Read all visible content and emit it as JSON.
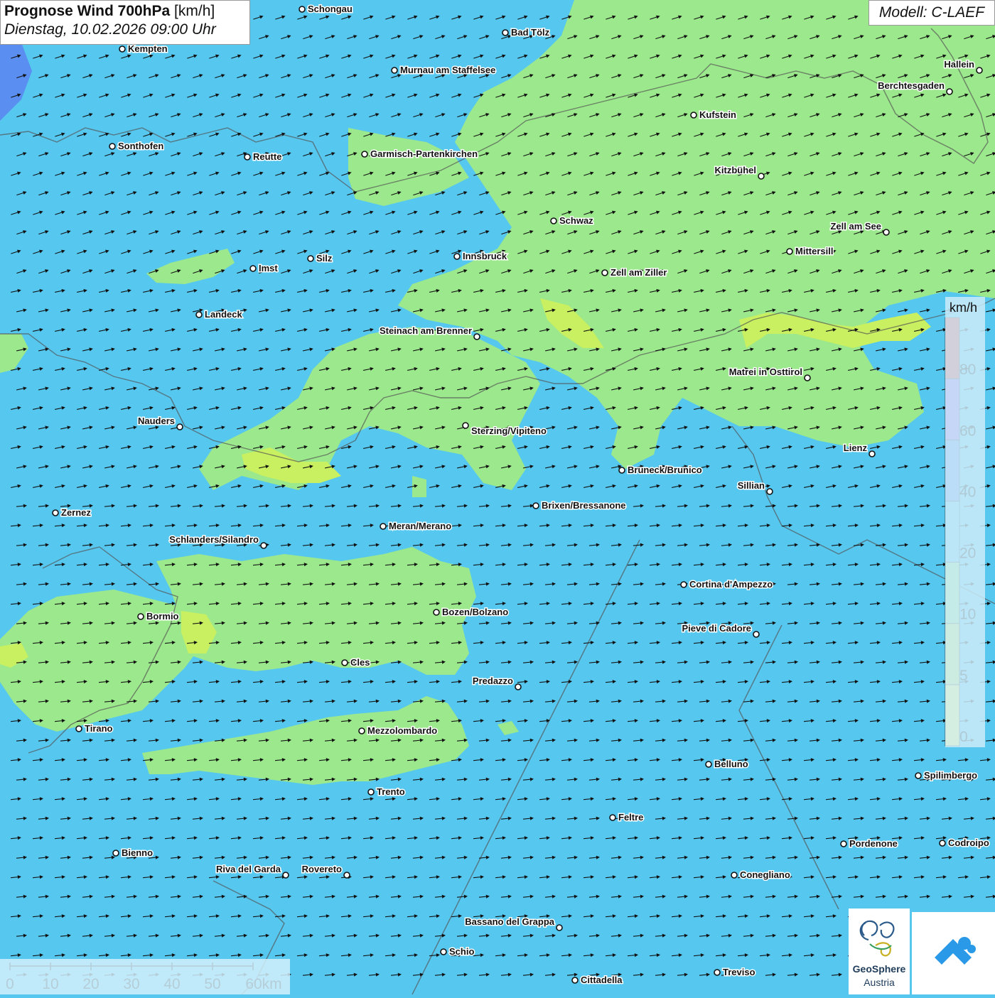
{
  "header": {
    "title_bold": "Prognose Wind 700hPa",
    "title_unit": "[km/h]",
    "subtitle": "Dienstag, 10.02.2026 09:00 Uhr",
    "model": "Modell: C-LAEF"
  },
  "legend": {
    "unit": "km/h",
    "colors": [
      "#ffff66",
      "#c8f060",
      "#9ce88c",
      "#56c7ef",
      "#5b8ef0",
      "#9a5cf0",
      "#f03a3a"
    ],
    "labels": [
      "0",
      "5",
      "10",
      "20",
      "40",
      "60",
      "80"
    ]
  },
  "scale": {
    "ticks": [
      "0",
      "10",
      "20",
      "30",
      "40",
      "50",
      "60km"
    ]
  },
  "logo": {
    "line1": "GeoSphere",
    "line2": "Austria"
  },
  "cities": [
    {
      "name": "Schongau",
      "side": "r"
    },
    {
      "name": "Bad Tölz",
      "side": "r"
    },
    {
      "name": "Kempten",
      "side": "r"
    },
    {
      "name": "Murnau am Staffelsee",
      "side": "r"
    },
    {
      "name": "Hallein",
      "side": "l"
    },
    {
      "name": "Berchtesgaden",
      "side": "l"
    },
    {
      "name": "Kufstein",
      "side": "r"
    },
    {
      "name": "Sonthofen",
      "side": "r"
    },
    {
      "name": "Reutte",
      "side": "r"
    },
    {
      "name": "Garmisch-Partenkirchen",
      "side": "r"
    },
    {
      "name": "Kitzbühel",
      "side": "l"
    },
    {
      "name": "Schwaz",
      "side": "r"
    },
    {
      "name": "Zell am See",
      "side": "l"
    },
    {
      "name": "Mittersill",
      "side": "r"
    },
    {
      "name": "Imst",
      "side": "r"
    },
    {
      "name": "Silz",
      "side": "r"
    },
    {
      "name": "Innsbruck",
      "side": "r"
    },
    {
      "name": "Zell am Ziller",
      "side": "r"
    },
    {
      "name": "Landeck",
      "side": "r"
    },
    {
      "name": "Steinach am Brenner",
      "side": "l"
    },
    {
      "name": "Matrei in Osttirol",
      "side": "l"
    },
    {
      "name": "Nauders",
      "side": "l"
    },
    {
      "name": "Sterzing/Vipiteno",
      "side": "rb"
    },
    {
      "name": "Lienz",
      "side": "l"
    },
    {
      "name": "Bruneck/Brunico",
      "side": "r"
    },
    {
      "name": "Sillian",
      "side": "l"
    },
    {
      "name": "Brixen/Bressanone",
      "side": "r"
    },
    {
      "name": "Zernez",
      "side": "r"
    },
    {
      "name": "Meran/Merano",
      "side": "r"
    },
    {
      "name": "Schlanders/Silandro",
      "side": "l"
    },
    {
      "name": "Cortina d'Ampezzo",
      "side": "r"
    },
    {
      "name": "Bozen/Bolzano",
      "side": "r"
    },
    {
      "name": "Bormio",
      "side": "r"
    },
    {
      "name": "Pieve di Cadore",
      "side": "l"
    },
    {
      "name": "Cles",
      "side": "r"
    },
    {
      "name": "Predazzo",
      "side": "l"
    },
    {
      "name": "Tirano",
      "side": "r"
    },
    {
      "name": "Mezzolombardo",
      "side": "r"
    },
    {
      "name": "Belluno",
      "side": "r"
    },
    {
      "name": "Spilimbergo",
      "side": "r"
    },
    {
      "name": "Trento",
      "side": "r"
    },
    {
      "name": "Feltre",
      "side": "r"
    },
    {
      "name": "Pordenone",
      "side": "r"
    },
    {
      "name": "Codroipo",
      "side": "r"
    },
    {
      "name": "Bienno",
      "side": "r"
    },
    {
      "name": "Riva del Garda",
      "side": "l"
    },
    {
      "name": "Rovereto",
      "side": "l"
    },
    {
      "name": "Conegliano",
      "side": "r"
    },
    {
      "name": "Bassano del Grappa",
      "side": "l"
    },
    {
      "name": "Schio",
      "side": "r"
    },
    {
      "name": "Treviso",
      "side": "r"
    },
    {
      "name": "Cittadella",
      "side": "r"
    }
  ]
}
